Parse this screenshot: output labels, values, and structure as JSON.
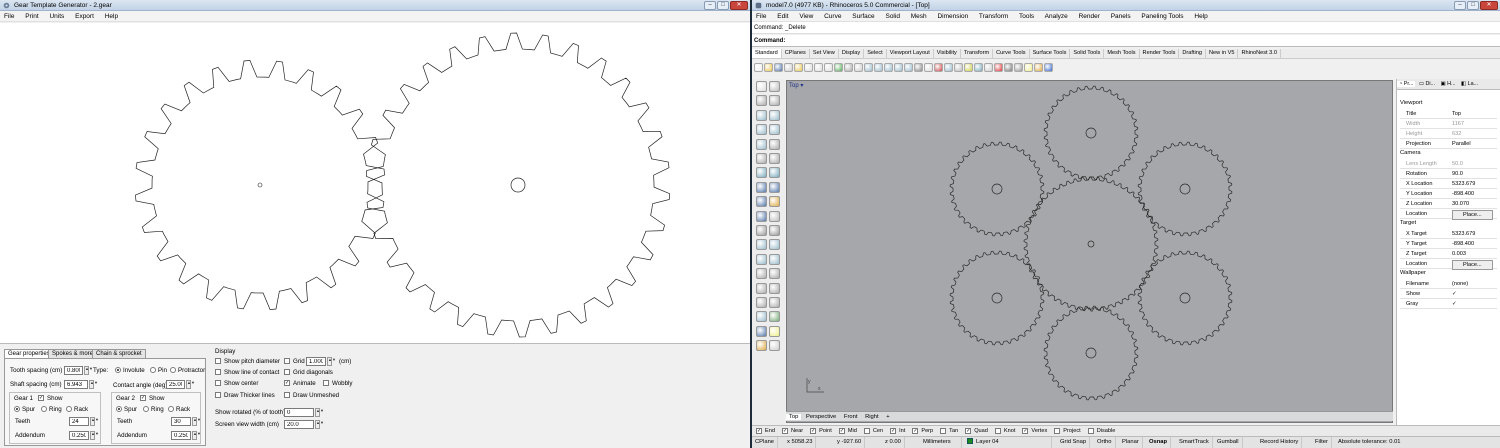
{
  "gear_app": {
    "title": "Gear Template Generator - 2.gear",
    "menu": [
      "File",
      "Print",
      "Units",
      "Export",
      "Help"
    ],
    "tabs": [
      "Gear properties",
      "Spokes & more",
      "Chain & sprocket"
    ],
    "tooth_spacing_label": "Tooth spacing (cm)",
    "tooth_spacing": "0.800",
    "shaft_spacing_label": "Shaft spacing (cm)",
    "shaft_spacing": "6.943",
    "type_label": "Type:",
    "type_options": [
      "Involute",
      "Pin",
      "Protractor"
    ],
    "contact_angle_label": "Contact angle (deg)",
    "contact_angle": "25.00",
    "gear1": {
      "label": "Gear 1",
      "show": "Show",
      "kinds": [
        "Spur",
        "Ring",
        "Rack"
      ],
      "teeth_label": "Teeth",
      "teeth": "24",
      "addendum_label": "Addendum",
      "addendum": "0.250"
    },
    "gear2": {
      "label": "Gear 2",
      "show": "Show",
      "kinds": [
        "Spur",
        "Ring",
        "Rack"
      ],
      "teeth_label": "Teeth",
      "teeth": "30",
      "addendum_label": "Addendum",
      "addendum": "0.250"
    },
    "display": {
      "label": "Display",
      "col1": [
        "Show pitch diameter",
        "Show line of contact",
        "Show center",
        "Draw Thicker lines"
      ],
      "grid_label": "Grid",
      "grid_value": "1.000",
      "grid_unit": "(cm)",
      "col2": [
        "Grid diagonals",
        "Animate",
        "Draw Unmeshed"
      ],
      "wobbly": "Wobbly",
      "show_rotated_label": "Show rotated (% of tooth)",
      "show_rotated": "0",
      "screen_width_label": "Screen view width (cm)",
      "screen_width": "20.0"
    }
  },
  "rhino": {
    "title": "model7.0 (4977 KB) - Rhinoceros 5.0 Commercial - [Top]",
    "menu": [
      "File",
      "Edit",
      "View",
      "Curve",
      "Surface",
      "Solid",
      "Mesh",
      "Dimension",
      "Transform",
      "Tools",
      "Analyze",
      "Render",
      "Panels",
      "Paneling Tools",
      "Help"
    ],
    "command_history": "Command: _Delete",
    "command_label": "Command:",
    "toolbar_tabs": [
      "Standard",
      "CPlanes",
      "Set View",
      "Display",
      "Select",
      "Viewport Layout",
      "Visibility",
      "Transform",
      "Curve Tools",
      "Surface Tools",
      "Solid Tools",
      "Mesh Tools",
      "Render Tools",
      "Drafting",
      "New in V5",
      "RhinoNest 3.0"
    ],
    "viewport_label": "Top",
    "view_tabs": [
      "Top",
      "Perspective",
      "Front",
      "Right"
    ],
    "panel_tabs": [
      "Pr...",
      "Di...",
      "H...",
      "La..."
    ],
    "properties": {
      "viewport_header": "Viewport",
      "viewport": [
        [
          "Title",
          "Top"
        ],
        [
          "Width",
          "1167"
        ],
        [
          "Height",
          "632"
        ],
        [
          "Projection",
          "Parallel"
        ]
      ],
      "camera_header": "Camera",
      "camera": [
        [
          "Lens Length",
          "50.0"
        ],
        [
          "Rotation",
          "90.0"
        ],
        [
          "X Location",
          "5323.679"
        ],
        [
          "Y Location",
          "-898.400"
        ],
        [
          "Z Location",
          "30.070"
        ],
        [
          "Location",
          "Place..."
        ]
      ],
      "target_header": "Target",
      "target": [
        [
          "X Target",
          "5323.679"
        ],
        [
          "Y Target",
          "-898.400"
        ],
        [
          "Z Target",
          "0.003"
        ],
        [
          "Location",
          "Place..."
        ]
      ],
      "wallpaper_header": "Wallpaper",
      "wallpaper": [
        [
          "Filename",
          "(none)"
        ],
        [
          "Show",
          "✓"
        ],
        [
          "Gray",
          "✓"
        ]
      ]
    },
    "osnaps": [
      [
        "End",
        true
      ],
      [
        "Near",
        true
      ],
      [
        "Point",
        true
      ],
      [
        "Mid",
        true
      ],
      [
        "Cen",
        false
      ],
      [
        "Int",
        true
      ],
      [
        "Perp",
        true
      ],
      [
        "Tan",
        false
      ],
      [
        "Quad",
        true
      ],
      [
        "Knot",
        false
      ],
      [
        "Vertex",
        true
      ],
      [
        "Project",
        false
      ],
      [
        "Disable",
        false
      ]
    ],
    "status": {
      "cplane": "CPlane",
      "x": "x 5058.23",
      "y": "y -927.60",
      "z": "z 0.00",
      "units": "Millimeters",
      "layer": "Layer 04",
      "grid_snap": "Grid Snap",
      "ortho": "Ortho",
      "planar": "Planar",
      "osnap": "Osnap",
      "smarttrack": "SmartTrack",
      "gumball": "Gumball",
      "history": "Record History",
      "filter": "Filter",
      "tolerance": "Absolute tolerance: 0.01"
    },
    "colors": {
      "viewport_bg": "#a5a7aa",
      "layer_swatch": "#1f8a1f"
    }
  }
}
